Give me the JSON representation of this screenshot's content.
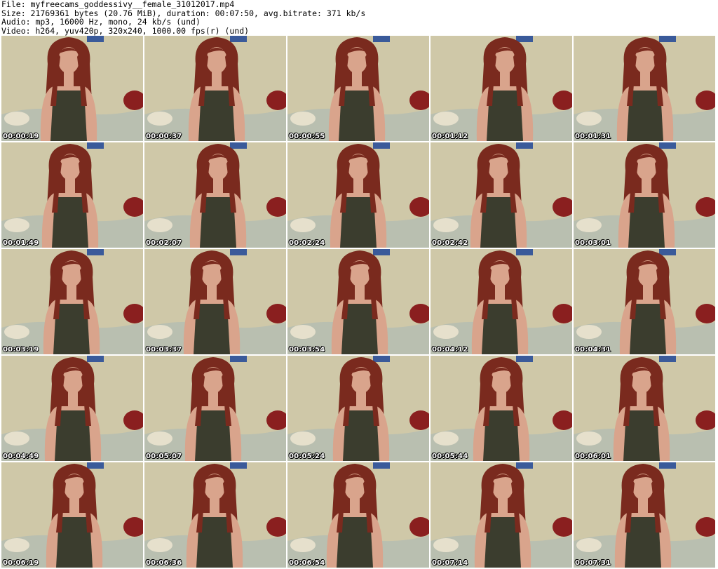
{
  "header": {
    "file_line": "File: myfreecams_goddessivy__female_31012017.mp4",
    "size_line": "Size: 21769361 bytes (20.76 MiB), duration: 00:07:50, avg.bitrate: 371 kb/s",
    "audio_line": "Audio: mp3, 16000 Hz, mono, 24 kb/s (und)",
    "video_line": "Video: h264, yuv420p, 320x240, 1000.00 fps(r) (und)"
  },
  "thumbnails": [
    {
      "timestamp": "00:00:19"
    },
    {
      "timestamp": "00:00:37"
    },
    {
      "timestamp": "00:00:55"
    },
    {
      "timestamp": "00:01:12"
    },
    {
      "timestamp": "00:01:31"
    },
    {
      "timestamp": "00:01:49"
    },
    {
      "timestamp": "00:02:07"
    },
    {
      "timestamp": "00:02:24"
    },
    {
      "timestamp": "00:02:42"
    },
    {
      "timestamp": "00:03:01"
    },
    {
      "timestamp": "00:03:19"
    },
    {
      "timestamp": "00:03:37"
    },
    {
      "timestamp": "00:03:54"
    },
    {
      "timestamp": "00:04:12"
    },
    {
      "timestamp": "00:04:31"
    },
    {
      "timestamp": "00:04:49"
    },
    {
      "timestamp": "00:05:07"
    },
    {
      "timestamp": "00:05:24"
    },
    {
      "timestamp": "00:05:44"
    },
    {
      "timestamp": "00:06:01"
    },
    {
      "timestamp": "00:06:19"
    },
    {
      "timestamp": "00:06:36"
    },
    {
      "timestamp": "00:06:54"
    },
    {
      "timestamp": "00:07:14"
    },
    {
      "timestamp": "00:07:31"
    }
  ],
  "colors": {
    "wall": "#cfc8a8",
    "bedding": "#b9bfb0",
    "hair": "#7a2a1e",
    "skin": "#d9a48c",
    "top": "#3b3d2e",
    "pillow": "#8a1f1f",
    "poster": "#3a5a9a"
  }
}
